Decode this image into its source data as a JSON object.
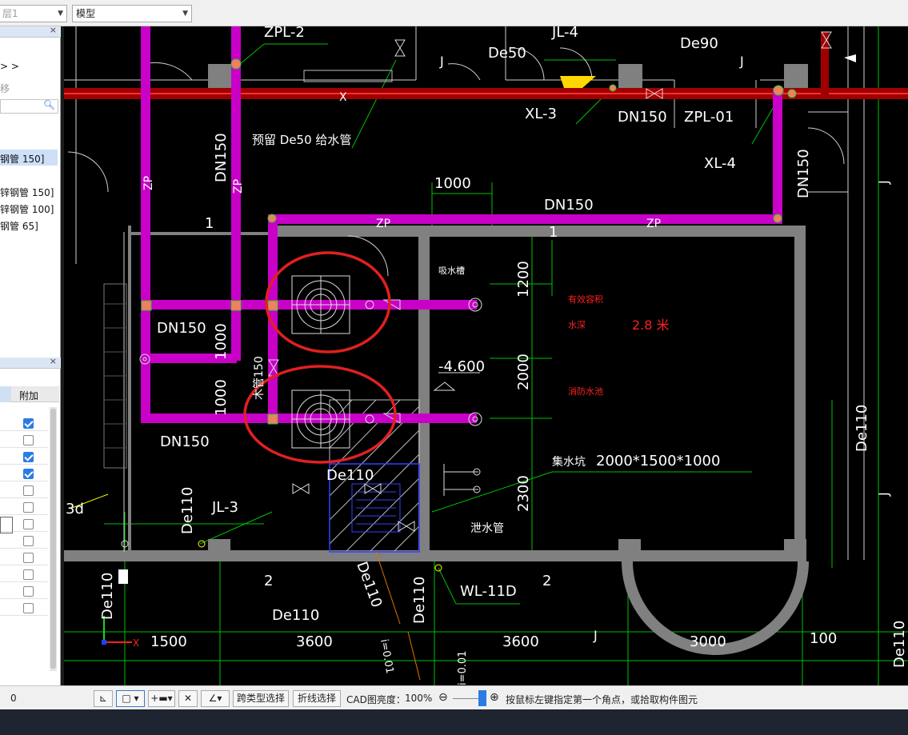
{
  "toolbar": {
    "floor_value": "层1",
    "view_value": "模型"
  },
  "left_panel": {
    "item_arrows": "> >",
    "item_move": "移",
    "properties": [
      {
        "label": "钢管 150]",
        "selected": true
      },
      {
        "label": "锌钢管 150]",
        "selected": false
      },
      {
        "label": "锌钢管 100]",
        "selected": false
      },
      {
        "label": "钢管 65]",
        "selected": false
      }
    ],
    "grid_header_add": "附加",
    "checkboxes": [
      true,
      false,
      true,
      true,
      false,
      false,
      false,
      false,
      false,
      false,
      false,
      false
    ]
  },
  "drawing": {
    "labels": {
      "zpl2": "ZPL-2",
      "jl4": "JL-4",
      "de50": "De50",
      "de90": "De90",
      "x": "X",
      "j": "J",
      "xl3": "XL-3",
      "dn150": "DN150",
      "zpl01": "ZPL-01",
      "xl4": "XL-4",
      "reserve": "预留 De50 给水管",
      "zp": "ZP",
      "one": "1",
      "dim1000": "1000",
      "suction": "吸水槽",
      "dim1200": "1200",
      "eff_vol": "有效容积",
      "water_depth": "水深",
      "depth_val": "2.8 米",
      "elev": "-4.600",
      "dim2000": "2000",
      "fire_pool": "消防水池",
      "sump": "集水坑",
      "sump_size": "2000*1500*1000",
      "de110": "De110",
      "jl3": "JL-3",
      "dim2300": "2300",
      "drain": "泄水管",
      "wl11d": "WL-11D",
      "two": "2",
      "three_d": "3d",
      "d1500": "1500",
      "d3600": "3600",
      "d3000": "3000",
      "d100": "100",
      "slope1": "i=0.01",
      "slope2": "i=0.01",
      "mao": "木管150"
    }
  },
  "status": {
    "coord": "0",
    "btn_cross": "跨类型选择",
    "btn_poly": "折线选择",
    "cad_brightness_label": "CAD图亮度：",
    "cad_brightness_value": "100%",
    "hint": "按鼠标左键指定第一个角点，或拾取构件图元"
  },
  "colors": {
    "pipe": "#c800c8",
    "red_pipe": "#b00000",
    "wall": "#808080",
    "grid": "#00ff00",
    "annot_red": "#ff2020",
    "circle_mark": "#e02020"
  }
}
